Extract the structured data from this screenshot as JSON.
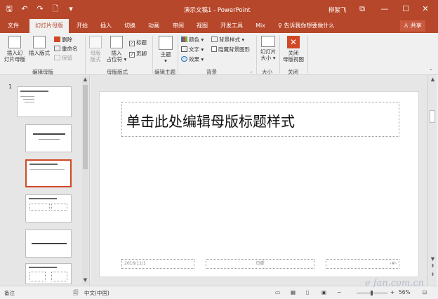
{
  "window": {
    "title": "演示文稿1 - PowerPoint",
    "user": "柳絮飞",
    "qat_save": "🖫",
    "qat_undo": "↶",
    "qat_redo": "↷",
    "qat_new": "🗋",
    "qat_more": "▾",
    "btn_ribbon_opts": "⧉",
    "btn_minimize": "—",
    "btn_maximize": "☐",
    "btn_close": "✕"
  },
  "tabs": [
    {
      "label": "文件"
    },
    {
      "label": "幻灯片母版"
    },
    {
      "label": "开始"
    },
    {
      "label": "插入"
    },
    {
      "label": "切换"
    },
    {
      "label": "动画"
    },
    {
      "label": "审阅"
    },
    {
      "label": "视图"
    },
    {
      "label": "开发工具"
    },
    {
      "label": "Mix"
    }
  ],
  "tellme": "♀ 告诉我你想要做什么",
  "share": "♙ 共享",
  "ribbon": {
    "insert_master": "插入幻\n灯片母版",
    "insert_layout": "插入版式",
    "delete": "删除",
    "rename": "重命名",
    "preserve": "保留",
    "group_edit_master": "编辑母版",
    "master_layout": "母版\n版式",
    "insert_placeholder": "插入\n占位符 ▾",
    "title_cb": "标题",
    "footer_cb": "页脚",
    "group_master_layout": "母版版式",
    "themes": "主题\n▾",
    "group_edit_theme": "编辑主题",
    "colors": "颜色 ▾",
    "fonts": "文字 ▾",
    "effects": "效果 ▾",
    "bg_styles": "背景样式 ▾",
    "hide_bg": "隐藏背景图形",
    "group_background": "背景",
    "slide_size": "幻灯片\n大小 ▾",
    "group_size": "大小",
    "close_master": "关闭\n母版视图",
    "group_close": "关闭"
  },
  "thumbs": {
    "number": "1"
  },
  "slide": {
    "title_placeholder": "单击此处编辑母版标题样式",
    "date": "2016/11/1",
    "footer": "页脚",
    "page": "‹#›"
  },
  "statusbar": {
    "notes": "备注",
    "language": "中文(中国)",
    "zoom": "56%"
  },
  "watermark": "e fan.com.cn"
}
